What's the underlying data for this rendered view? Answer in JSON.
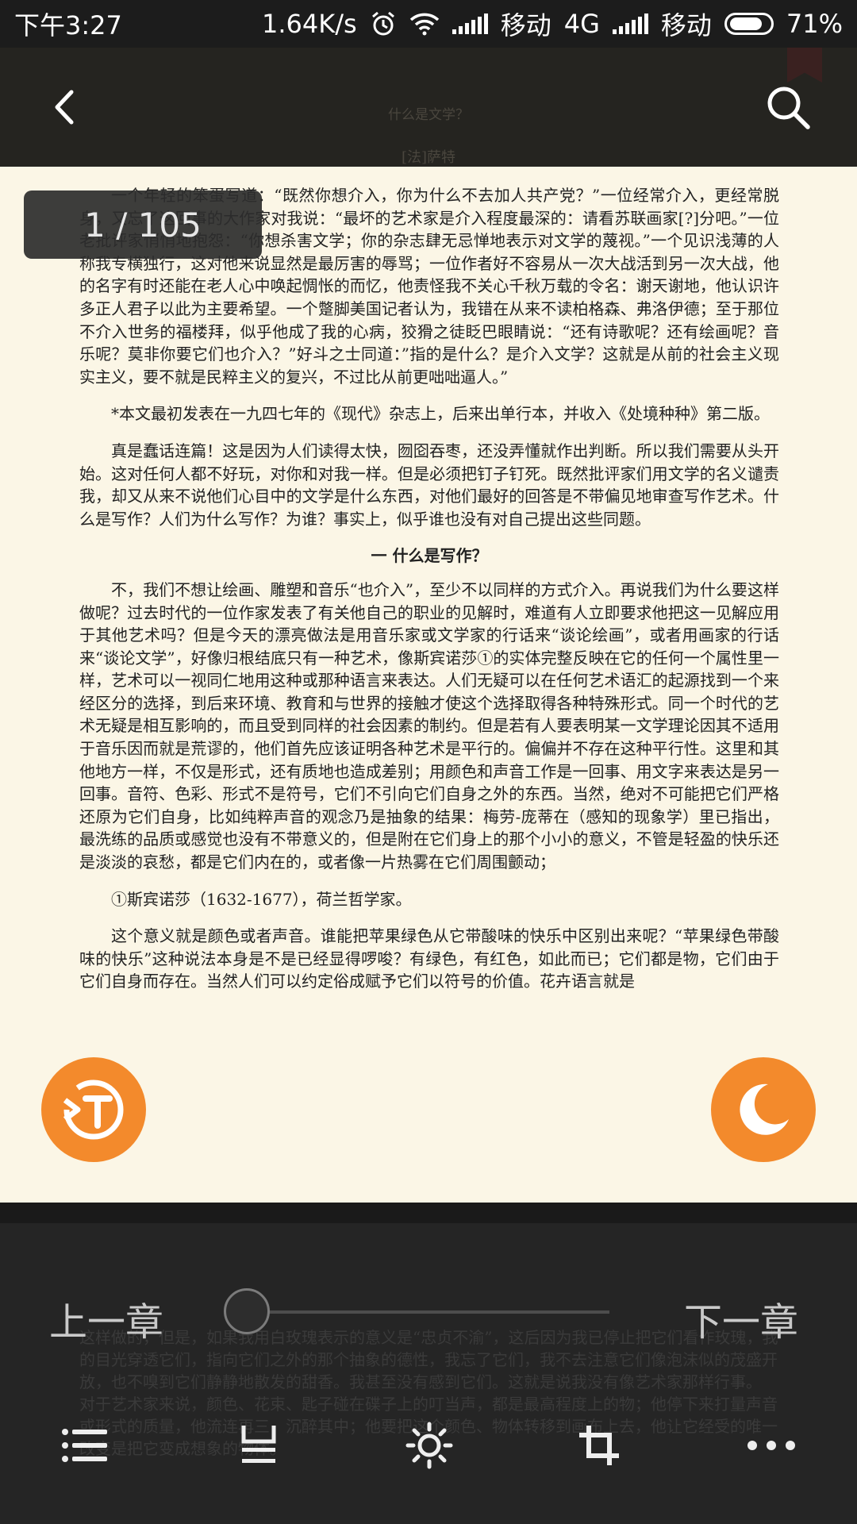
{
  "status": {
    "time": "下午3:27",
    "speed": "1.64K/s",
    "carrier1": "移动",
    "network": "4G",
    "carrier2": "移动",
    "battery": "71%"
  },
  "header": {
    "ghost_title": "什么是文学？",
    "ghost_author": "[法]萨特"
  },
  "page_indicator": "1 / 105",
  "content": {
    "p1": "一个年轻的笨蛋写道：“既然你想介入，你为什么不去加人共产党？”一位经常介入，更经常脱身，又忘了这回事的大作家对我说：“最坏的艺术家是介入程度最深的：请看苏联画家[?]分吧。”一位老批评家悄悄地抱怨：“你想杀害文学；你的杂志肆无忌惮地表示对文学的蔑视。”一个见识浅薄的人称我专横独行，这对他来说显然是最厉害的辱骂；一位作者好不容易从一次大战活到另一次大战，他的名字有时还能在老人心中唤起惆怅的而忆，他责怪我不关心千秋万载的令名：谢天谢地，他认识许多正人君子以此为主要希望。一个蹩脚美国记者认为，我错在从来不读柏格森、弗洛伊德；至于那位不介入世务的福楼拜，似乎他成了我的心病，狡猾之徒眨巴眼睛说：“还有诗歌呢？还有绘画呢？音乐呢？莫非你要它们也介入？”好斗之士同道：”指的是什么？是介入文学？这就是从前的社会主义现实主义，要不就是民粹主义的复兴，不过比从前更咄咄逼人。”",
    "p2": "*本文最初发表在一九四七年的《现代》杂志上，后来出单行本，并收入《处境种种》第二版。",
    "p3": "真是蠢话连篇！这是因为人们读得太快，囫囵吞枣，还没弄懂就作出判断。所以我们需要从头开始。这对任何人都不好玩，对你和对我一样。但是必须把钉子钉死。既然批评家们用文学的名义谴责我，却又从来不说他们心目中的文学是什么东西，对他们最好的回答是不带偏见地审查写作艺术。什么是写作？人们为什么写作？为谁？事实上，似乎谁也没有对自己提出这些同题。",
    "heading": "一  什么是写作？",
    "p4": "不，我们不想让绘画、雕塑和音乐“也介入”，至少不以同样的方式介入。再说我们为什么要这样做呢？过去时代的一位作家发表了有关他自己的职业的见解时，难道有人立即要求他把这一见解应用于其他艺术吗？但是今天的漂亮做法是用音乐家或文学家的行话来“谈论绘画”，或者用画家的行话来“谈论文学”，好像归根结底只有一种艺术，像斯宾诺莎①的实体完整反映在它的任何一个属性里一样，艺术可以一视同仁地用这种或那种语言来表达。人们无疑可以在任何艺术语汇的起源找到一个来经区分的选择，到后来环境、教育和与世界的接触才使这个选择取得各种特殊形式。同一个时代的艺术无疑是相互影响的，而且受到同样的社会因素的制约。但是若有人要表明某一文学理论因其不适用于音乐因而就是荒谬的，他们首先应该证明各种艺术是平行的。偏偏并不存在这种平行性。这里和其他地方一样，不仅是形式，还有质地也造成差别；用颜色和声音工作是一回事、用文字来表达是另一回事。音符、色彩、形式不是符号，它们不引向它们自身之外的东西。当然，绝对不可能把它们严格还原为它们自身，比如纯粹声音的观念乃是抽象的结果：梅劳-庞蒂在（感知的现象学）里已指出，最洗练的品质或感觉也没有不带意义的，但是附在它们身上的那个小小的意义，不管是轻盈的快乐还是淡淡的哀愁，都是它们内在的，或者像一片热雾在它们周围颤动；",
    "footnote": "①斯宾诺莎（1632-1677），荷兰哲学家。",
    "p5": "这个意义就是颜色或者声音。谁能把苹果绿色从它带酸味的快乐中区别出来呢？“苹果绿色带酸味的快乐”这种说法本身是不是已经显得啰唆？有绿色，有红色，如此而已；它们都是物，它们由于它们自身而存在。当然人们可以约定俗成赋予它们以符号的价值。花卉语言就是"
  },
  "bottom_ghost": [
    "这样做的，但是，如果我用白玫瑰表示的意义是“忠贞不渝”，这后因为我已停止把它们看作玫瑰，我的目光穿透它们，指向它们之外的那个抽象的德性，我忘了它们，我不去注意它们像泡沫似的茂盛开放，也不嗅到它们静静地散发的甜香。我甚至没有感到它们。这就是说我没有像艺术家那样行事。",
    "对于艺术家来说，颜色、花束、匙子碰在碟子上的叮当声，都是最高程度上的物；他停下来打量声音或形式的质量，他流连再三，沉醉其中；他要把这个颜色、物体转移到画布上去，他让它经受的唯一改变是把它变成想象的物体。"
  ],
  "nav": {
    "prev": "上一章",
    "next": "下一章",
    "progress": 0
  },
  "toolbar": [
    "catalog-icon",
    "page-mode-icon",
    "brightness-icon",
    "crop-icon",
    "more-icon"
  ],
  "colors": {
    "accent": "#f38a2c",
    "page_bg": "#fbf6e6",
    "panel_bg": "#252525"
  }
}
